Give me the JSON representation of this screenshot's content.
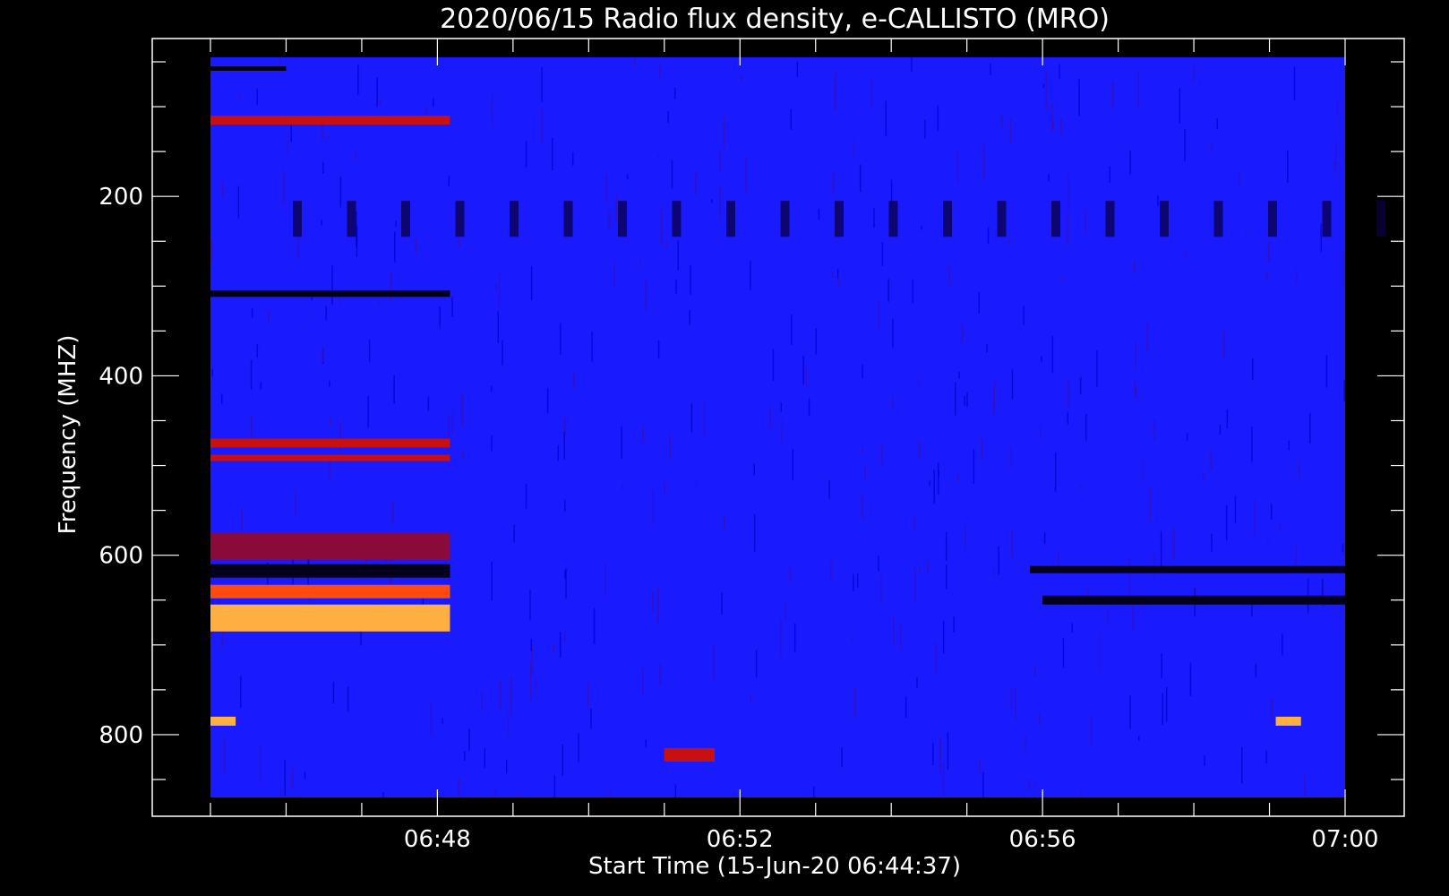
{
  "chart_data": {
    "type": "heatmap",
    "title": "2020/06/15  Radio flux density, e-CALLISTO (MRO)",
    "xlabel": "Start Time (15-Jun-20 06:44:37)",
    "ylabel": "Frequency (MHZ)",
    "x_range": [
      "06:44:37",
      "07:00:00"
    ],
    "xlim": [
      "06:45:00",
      "07:00:00"
    ],
    "ylim": [
      45,
      870
    ],
    "y_inverted": true,
    "x_ticks": [
      "06:48",
      "06:52",
      "06:56",
      "07:00"
    ],
    "y_ticks": [
      200,
      400,
      600,
      800
    ],
    "colormap": [
      "#000000",
      "#1010ff",
      "#4a1fd0",
      "#c00000",
      "#ff4000",
      "#ffffc0"
    ],
    "background_color": "#1a1aff",
    "features": [
      {
        "freq_mhz": [
          470,
          480
        ],
        "time": [
          "06:45:00",
          "06:48:10"
        ],
        "level": "red"
      },
      {
        "freq_mhz": [
          488,
          495
        ],
        "time": [
          "06:45:00",
          "06:48:10"
        ],
        "level": "red"
      },
      {
        "freq_mhz": [
          575,
          605
        ],
        "time": [
          "06:45:00",
          "06:48:10"
        ],
        "level": "dark-red"
      },
      {
        "freq_mhz": [
          610,
          625
        ],
        "time": [
          "06:45:00",
          "06:48:10"
        ],
        "level": "black"
      },
      {
        "freq_mhz": [
          633,
          648
        ],
        "time": [
          "06:45:00",
          "06:48:10"
        ],
        "level": "bright"
      },
      {
        "freq_mhz": [
          655,
          685
        ],
        "time": [
          "06:45:00",
          "06:48:10"
        ],
        "level": "bright-yellow"
      },
      {
        "freq_mhz": [
          305,
          312
        ],
        "time": [
          "06:45:00",
          "06:48:10"
        ],
        "level": "black"
      },
      {
        "freq_mhz": [
          55,
          60
        ],
        "time": [
          "06:45:00",
          "06:46:00"
        ],
        "level": "black"
      },
      {
        "freq_mhz": [
          110,
          120
        ],
        "time": [
          "06:45:00",
          "06:48:10"
        ],
        "level": "red"
      },
      {
        "freq_mhz": [
          612,
          620
        ],
        "time": [
          "06:55:50",
          "07:00:00"
        ],
        "level": "black"
      },
      {
        "freq_mhz": [
          645,
          655
        ],
        "time": [
          "06:56:00",
          "07:00:00"
        ],
        "level": "black"
      },
      {
        "freq_mhz": [
          780,
          790
        ],
        "time": [
          "06:45:00",
          "06:45:20"
        ],
        "level": "bright-yellow"
      },
      {
        "freq_mhz": [
          780,
          790
        ],
        "time": [
          "06:59:05",
          "06:59:25"
        ],
        "level": "bright-yellow"
      },
      {
        "freq_mhz": [
          815,
          830
        ],
        "time": [
          "06:51:00",
          "06:51:40"
        ],
        "level": "red"
      }
    ]
  }
}
